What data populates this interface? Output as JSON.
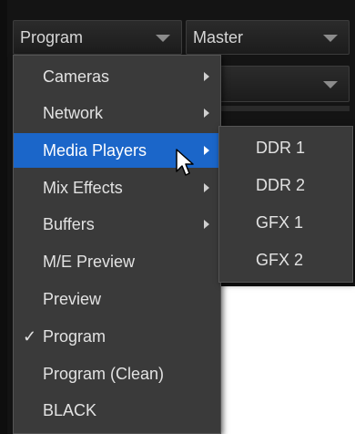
{
  "source_selector": {
    "value": "Program"
  },
  "target_selector": {
    "value": "Master"
  },
  "menu": {
    "items": [
      {
        "label": "Cameras",
        "has_submenu": true
      },
      {
        "label": "Network",
        "has_submenu": true
      },
      {
        "label": "Media Players",
        "has_submenu": true,
        "highlighted": true
      },
      {
        "label": "Mix Effects",
        "has_submenu": true
      },
      {
        "label": "Buffers",
        "has_submenu": true
      },
      {
        "label": "M/E Preview"
      },
      {
        "label": "Preview"
      },
      {
        "label": "Program",
        "checked": true
      },
      {
        "label": "Program (Clean)"
      },
      {
        "label": "BLACK"
      }
    ],
    "checkmark": "✓"
  },
  "submenu": {
    "items": [
      {
        "label": "DDR 1"
      },
      {
        "label": "DDR 2"
      },
      {
        "label": "GFX 1"
      },
      {
        "label": "GFX 2"
      }
    ]
  },
  "colors": {
    "highlight": "#1b66c9",
    "menu_bg": "#3a3a3a",
    "panel_bg": "#141414"
  }
}
